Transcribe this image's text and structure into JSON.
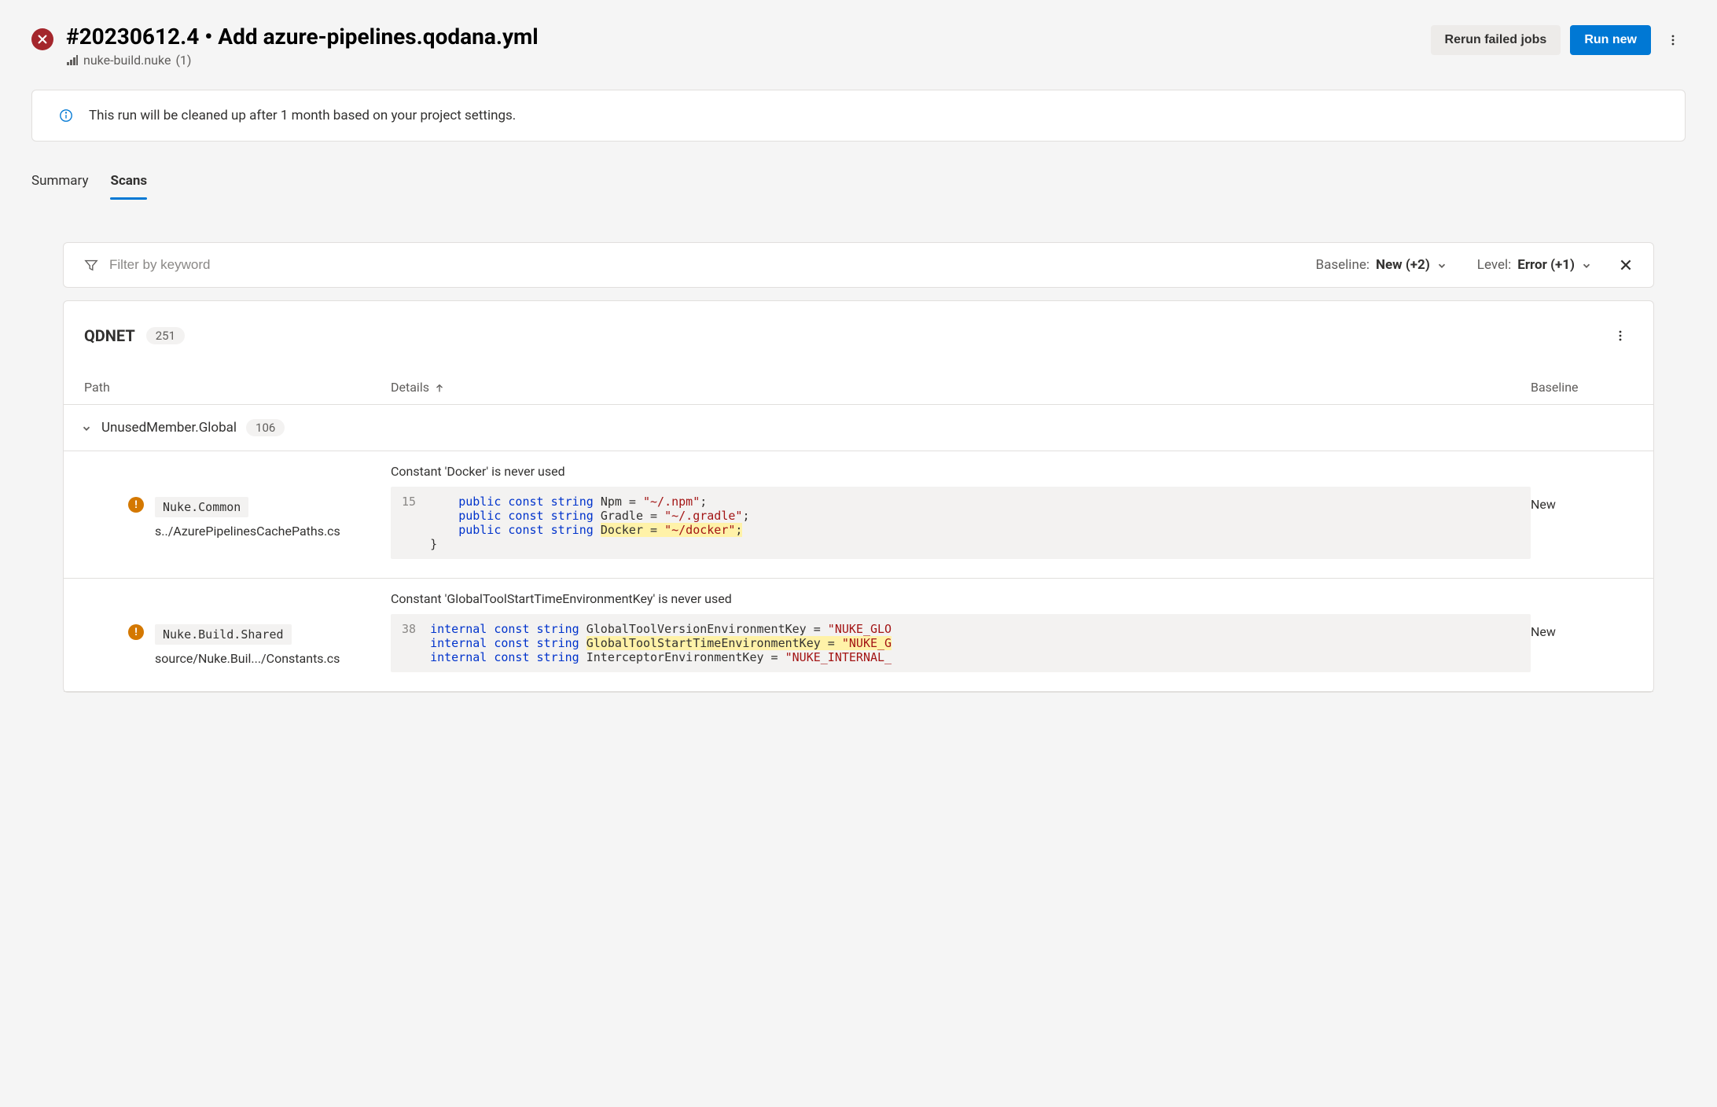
{
  "header": {
    "title": "#20230612.4 • Add azure-pipelines.qodana.yml",
    "repo": "nuke-build.nuke",
    "repo_count": "(1)"
  },
  "actions": {
    "rerun": "Rerun failed jobs",
    "run_new": "Run new"
  },
  "banner": {
    "text": "This run will be cleaned up after 1 month based on your project settings."
  },
  "tabs": {
    "summary": "Summary",
    "scans": "Scans"
  },
  "filter": {
    "placeholder": "Filter by keyword",
    "baseline_label": "Baseline: ",
    "baseline_value": "New (+2)",
    "level_label": "Level: ",
    "level_value": "Error (+1)"
  },
  "panel": {
    "title": "QDNET",
    "count": "251"
  },
  "columns": {
    "path": "Path",
    "details": "Details",
    "baseline": "Baseline"
  },
  "group": {
    "name": "UnusedMember.Global",
    "count": "106"
  },
  "issues": [
    {
      "namespace": "Nuke.Common",
      "filepath": "s../AzurePipelinesCachePaths.cs",
      "message": "Constant 'Docker' is never used",
      "line_num": "15",
      "baseline": "New",
      "code": [
        {
          "indent": "    ",
          "tokens": [
            {
              "t": "kw",
              "v": "public const"
            },
            {
              "t": "sp",
              "v": " "
            },
            {
              "t": "type",
              "v": "string"
            },
            {
              "t": "sp",
              "v": " "
            },
            {
              "t": "ident",
              "v": "Npm ="
            },
            {
              "t": "sp",
              "v": " "
            },
            {
              "t": "str",
              "v": "\"~/.npm\""
            },
            {
              "t": "ident",
              "v": ";"
            }
          ]
        },
        {
          "indent": "    ",
          "tokens": [
            {
              "t": "kw",
              "v": "public const"
            },
            {
              "t": "sp",
              "v": " "
            },
            {
              "t": "type",
              "v": "string"
            },
            {
              "t": "sp",
              "v": " "
            },
            {
              "t": "ident",
              "v": "Gradle ="
            },
            {
              "t": "sp",
              "v": " "
            },
            {
              "t": "str",
              "v": "\"~/.gradle\""
            },
            {
              "t": "ident",
              "v": ";"
            }
          ]
        },
        {
          "indent": "    ",
          "tokens": [
            {
              "t": "kw",
              "v": "public const"
            },
            {
              "t": "sp",
              "v": " "
            },
            {
              "t": "type",
              "v": "string"
            },
            {
              "t": "sp",
              "v": " "
            },
            {
              "t": "hl",
              "v": "Docker = "
            },
            {
              "t": "hlstr",
              "v": "\"~/docker\""
            },
            {
              "t": "hl",
              "v": ";"
            }
          ]
        },
        {
          "indent": "",
          "tokens": [
            {
              "t": "ident",
              "v": "}"
            }
          ]
        }
      ]
    },
    {
      "namespace": "Nuke.Build.Shared",
      "filepath": "source/Nuke.Buil.../Constants.cs",
      "message": "Constant 'GlobalToolStartTimeEnvironmentKey' is never used",
      "line_num": "38",
      "baseline": "New",
      "code": [
        {
          "indent": "",
          "tokens": [
            {
              "t": "kw",
              "v": "internal const"
            },
            {
              "t": "sp",
              "v": " "
            },
            {
              "t": "type",
              "v": "string"
            },
            {
              "t": "sp",
              "v": " "
            },
            {
              "t": "ident",
              "v": "GlobalToolVersionEnvironmentKey ="
            },
            {
              "t": "sp",
              "v": " "
            },
            {
              "t": "str",
              "v": "\"NUKE_GLO"
            }
          ]
        },
        {
          "indent": "",
          "tokens": [
            {
              "t": "kw",
              "v": "internal const"
            },
            {
              "t": "sp",
              "v": " "
            },
            {
              "t": "type",
              "v": "string"
            },
            {
              "t": "sp",
              "v": " "
            },
            {
              "t": "hl",
              "v": "GlobalToolStartTimeEnvironmentKey = "
            },
            {
              "t": "hlstr",
              "v": "\"NUKE_G"
            }
          ]
        },
        {
          "indent": "",
          "tokens": [
            {
              "t": "kw",
              "v": "internal const"
            },
            {
              "t": "sp",
              "v": " "
            },
            {
              "t": "type",
              "v": "string"
            },
            {
              "t": "sp",
              "v": " "
            },
            {
              "t": "ident",
              "v": "InterceptorEnvironmentKey ="
            },
            {
              "t": "sp",
              "v": " "
            },
            {
              "t": "str",
              "v": "\"NUKE_INTERNAL_"
            }
          ]
        }
      ]
    }
  ]
}
